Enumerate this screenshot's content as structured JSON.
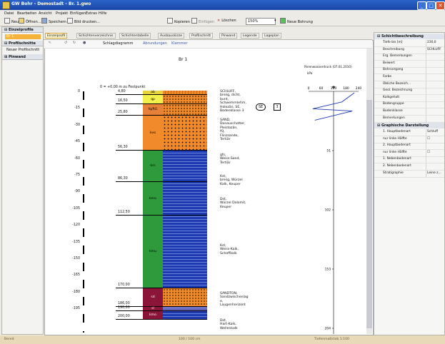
{
  "window": {
    "title": "GW Bohr - Demostadt - Br. 1.gwo",
    "min": "_",
    "max": "□",
    "close": "✕"
  },
  "menu": [
    "Datei",
    "Bearbeiten",
    "Ansicht",
    "Projekt",
    "Einfügen",
    "Extras",
    "Hilfe"
  ],
  "toolbar": {
    "neu": "Neu",
    "oeffnen": "Öffnen...",
    "speichern": "Speichern",
    "drucken": "Bild drucken...",
    "kopieren": "Kopieren",
    "einfuegen": "Einfügen",
    "loeschen": "Löschen",
    "zoom": "150%",
    "neue_bohrung": "Neue Bohrung"
  },
  "left_panel": {
    "einzelprofile": "Einzelprofile",
    "item_br1": "Br 1",
    "profilschnitte": "Profilschnitte",
    "neuer_profilschnitt": "Neuer Profilschnitt",
    "pinwand": "Pinwand"
  },
  "tabs": [
    "Einzelprofil",
    "Schichtenverzeichnis",
    "Schichtentabelle",
    "Ausbauskizze",
    "Profilschnitt",
    "Pinwand",
    "Legende",
    "Lageplan"
  ],
  "doc_toolbar": {
    "diagram": "Schlagdiagramm",
    "abrunden": "Abrundungen",
    "klammer": "Klammer"
  },
  "profile": {
    "name": "Br 1",
    "zero_label": "0 = +0,00 m zu Festpunkt",
    "depth_ticks": [
      "0",
      "-15",
      "-30",
      "-45",
      "-60",
      "-75",
      "-90",
      "-105",
      "-120",
      "-135",
      "-150",
      "-165",
      "-180",
      "-195"
    ],
    "layer_depths": [
      "4,80",
      "16,50",
      "25,80",
      "56,30",
      "86,30",
      "112,50",
      "170,00",
      "186,00",
      "190,00",
      "200,00"
    ],
    "codes": [
      "ab",
      "qp",
      "fq/RG",
      "kvo",
      "km",
      "kmo",
      "kmu",
      "sd",
      "sl",
      "kmo"
    ],
    "descriptions": [
      "SCHLUFF,\nbreiig, dicht,\nbunt,\nSchwemmlehm,\nHolozän, SE,\nBodenklasse 3",
      "SAND,\nDonauschotter,\nPleistozän,\nfQ,\nFlinzsande,\nTertiär",
      "gfs,\nWeiss-Sand,\nTertiär",
      "Kst,\nbreiig, Würzel\nKalk, Keuper",
      "Dst,\nWürzel Dolomit,\nKeuper",
      "Kst,\nWeiss-Kalk,\nScheffkalk",
      "SANDTON,\nSandzwischenlag\ne,\nLaugenhorizont",
      "Dst,\nHart-Kalk,\nWellenkalk"
    ],
    "markers": {
      "se": "SE",
      "num": "3"
    }
  },
  "water_chart": {
    "title": "Porenwasserdruck (07.01.2010)",
    "unit": "kPa",
    "x_ticks": [
      "0",
      "60",
      "120",
      "180",
      "240"
    ],
    "depth_labels": [
      "51",
      "102",
      "153",
      "204"
    ]
  },
  "chart_data": {
    "type": "line",
    "title": "Porenwasserdruck (07.01.2010)",
    "xlabel": "kPa",
    "x_ticks": [
      0,
      60,
      120,
      180,
      240
    ],
    "xlim": [
      0,
      240
    ],
    "ylim": [
      0,
      204
    ],
    "y_ticks": [
      51,
      102,
      153,
      204
    ],
    "series": [
      {
        "values": [
          [
            220,
            0
          ],
          [
            160,
            8
          ],
          [
            20,
            14
          ],
          [
            210,
            16
          ],
          [
            30,
            24
          ]
        ]
      }
    ]
  },
  "properties": {
    "section1": "Schichtbeschreibung",
    "rows1": [
      [
        "Tiefe bis [m]",
        "230,0"
      ],
      [
        "Beschreibung",
        "SCHLUFF"
      ],
      [
        "Erg. Bemerkungen",
        ""
      ],
      [
        "Beiwert",
        ""
      ],
      [
        "Bohrvorgang",
        ""
      ],
      [
        "Farbe",
        ""
      ],
      [
        "Übliche Bezeich...",
        ""
      ],
      [
        "Geol. Bezeichnung",
        ""
      ],
      [
        "Kalkgehalt",
        ""
      ],
      [
        "Bodengruppe",
        ""
      ],
      [
        "Bodenklasse",
        ""
      ],
      [
        "Bemerkungen",
        ""
      ]
    ],
    "section2": "Graphische Darstellung",
    "rows2": [
      [
        "1. Hauptbodenart",
        "Schluff"
      ],
      [
        "nur linke Hälfte",
        "☐"
      ],
      [
        "2. Hauptbodenart",
        ""
      ],
      [
        "nur linke Hälfte",
        "☐"
      ],
      [
        "1. Nebenbodenart",
        ""
      ],
      [
        "2. Nebenbodenart",
        ""
      ],
      [
        "Stratigraphie",
        "Leine z..."
      ]
    ]
  },
  "status": {
    "left": "Bereit",
    "middle": "100 / 100 cm",
    "right": "Tiefenmaßstab 1:100"
  }
}
